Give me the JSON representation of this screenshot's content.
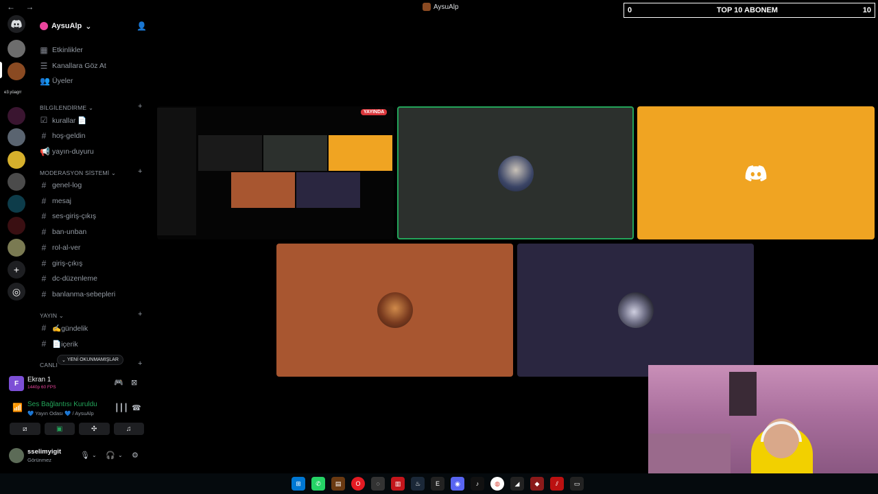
{
  "titlebar": {
    "title": "AysuAlp"
  },
  "overlay": {
    "left": "0",
    "label": "TOP 10 ABONEM",
    "right": "10"
  },
  "rail": {
    "text_server": "e3.yüagrr"
  },
  "server": {
    "name": "AysuAlp"
  },
  "menu": [
    {
      "label": "Etkinlikler",
      "icon": "calendar-icon"
    },
    {
      "label": "Kanallara Göz At",
      "icon": "browse-icon"
    },
    {
      "label": "Üyeler",
      "icon": "members-icon"
    }
  ],
  "categories": {
    "info": {
      "label": "BİLGİLENDİRME"
    },
    "mod": {
      "label": "MODERASYON SİSTEMİ"
    },
    "yayin": {
      "label": "YAYIN"
    },
    "canli": {
      "label": "CANLI"
    }
  },
  "channels": {
    "info": [
      "kurallar 📄",
      "hoş-geldin",
      "yayın-duyuru"
    ],
    "mod": [
      "genel-log",
      "mesaj",
      "ses-giriş-çıkış",
      "ban-unban",
      "rol-al-ver",
      "giriş-çıkış",
      "dc-düzenleme",
      "banlanma-sebepleri"
    ],
    "yayin": [
      "✍️gündelik",
      "📄içerik"
    ]
  },
  "new_unread": "YENİ OKUNMAMIŞLAR",
  "stream_panel": {
    "title": "Ekran 1",
    "quality": "1440p 60 FPS",
    "thumb_letter": "F"
  },
  "voice_panel": {
    "status": "Ses Bağlantısı Kuruldu",
    "channel": "💙 Yayın Odası 💙 / AysuAlp"
  },
  "user": {
    "name": "sselimyigit",
    "status": "Görünmez"
  },
  "stage": {
    "live_badge": "YAYINDA"
  },
  "colors": {
    "speaking": "#23a55a",
    "discord_tile": "#f0a422",
    "tile_brown": "#a85630",
    "tile_navy": "#2a2640",
    "tile_dark": "#2c302d",
    "live_red": "#da373c"
  }
}
